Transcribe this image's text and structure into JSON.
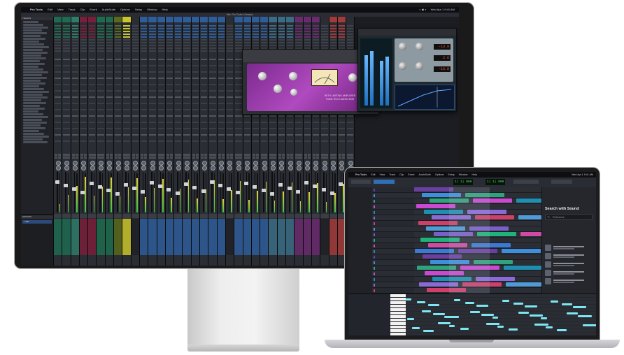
{
  "monitor": {
    "menubar": {
      "app": "Pro Tools",
      "items": [
        "Edit",
        "View",
        "Track",
        "Clip",
        "Event",
        "AudioSuite",
        "Options",
        "Setup",
        "Window",
        "Help"
      ],
      "clock": "Wed Apr 1 9:41 AM"
    },
    "window_title": "Mix: Pro Tools's Session",
    "tracks_panel_label": "TRACKS",
    "groups_panel_label": "GROUPS",
    "groups_item": "<All>",
    "strip_colors": [
      "#1f6b52",
      "#1f6b52",
      "#2e7d6b",
      "#7a1f3a",
      "#7a1f3a",
      "#1d6c4d",
      "#1d6c4d",
      "#5b6a1a",
      "#c9c62a",
      "#2a2d33",
      "#2f5d99",
      "#2f5d99",
      "#2f5d99",
      "#2f5d99",
      "#2f5d99",
      "#2f5d99",
      "#2f5d99",
      "#2f5d99",
      "#2f5d99",
      "#2f5d99",
      "#2a2d33",
      "#2f5d99",
      "#2f5d99",
      "#2f5d99",
      "#2f5d99",
      "#3b6c85",
      "#3b6c85",
      "#3b6c85",
      "#6a2a6e",
      "#6a2a6e",
      "#6a2a6e",
      "#2a2d33",
      "#a23a3a",
      "#a23a3a",
      "#2a2d33"
    ],
    "plugin_1": {
      "brand_line_1": "WITH LIMITING AMPLIFIER",
      "brand_line_2": "TUBE-TECH AUDIO ENG"
    },
    "plugin_2": {
      "readouts": [
        "-13.9",
        "2.6",
        "-13.8"
      ]
    }
  },
  "laptop": {
    "menubar": {
      "app": "Pro Tools",
      "items": [
        "Edit",
        "View",
        "Track",
        "Clip",
        "Event",
        "AudioSuite",
        "Options",
        "Setup",
        "Window",
        "Help"
      ],
      "clock": "Wed Apr 1 9:41 AM"
    },
    "counter_main": "1| 1| 000",
    "counter_alt": "1| 1| 000",
    "panel": {
      "title": "Search with Sound",
      "search_label": "Reference"
    },
    "clip_colors": [
      "#6b3fa0",
      "#3e8ede",
      "#2fa37c",
      "#c94ad1",
      "#1e8fb0",
      "#8a6bd6",
      "#cf3f6a",
      "#4e9bd8",
      "#7b5fc9",
      "#1fb27a",
      "#d14aa3",
      "#3b7ad4"
    ]
  }
}
